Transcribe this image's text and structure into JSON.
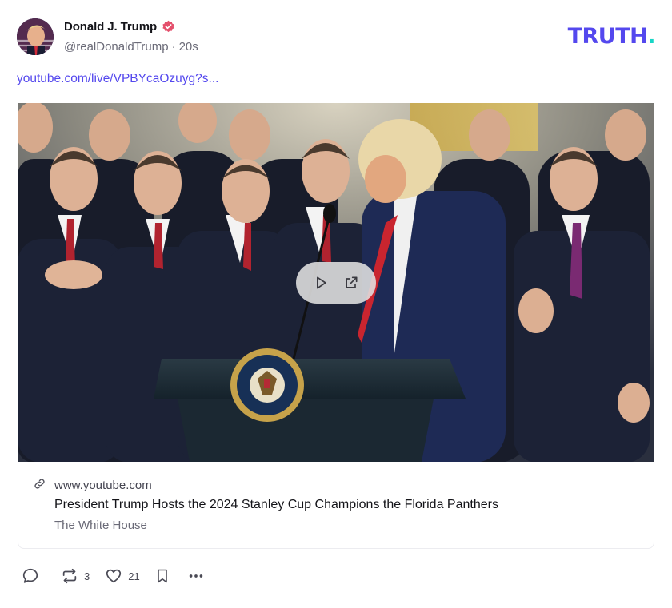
{
  "author": {
    "display_name": "Donald J. Trump",
    "handle": "@realDonaldTrump",
    "separator": "·",
    "time": "20s",
    "verified_color": "#e4506c"
  },
  "brand": {
    "part1": "TRUTH",
    "part2": ".",
    "colors": {
      "main": "#5448ee",
      "dot": "#17d6c6"
    }
  },
  "post": {
    "link_text": "youtube.com/live/VPBYcaOzuyg?s..."
  },
  "media": {
    "icons": [
      "play-icon",
      "external-link-icon"
    ],
    "seal_text": "PRESIDENT OF THE UNITED STATES · SEAL ·"
  },
  "link_card": {
    "domain": "www.youtube.com",
    "title": "President Trump Hosts the 2024 Stanley Cup Champions the Florida Panthers",
    "source": "The White House"
  },
  "actions": {
    "reply_count": "",
    "retruth_count": "3",
    "like_count": "21"
  },
  "accent_color": "#5448ee"
}
